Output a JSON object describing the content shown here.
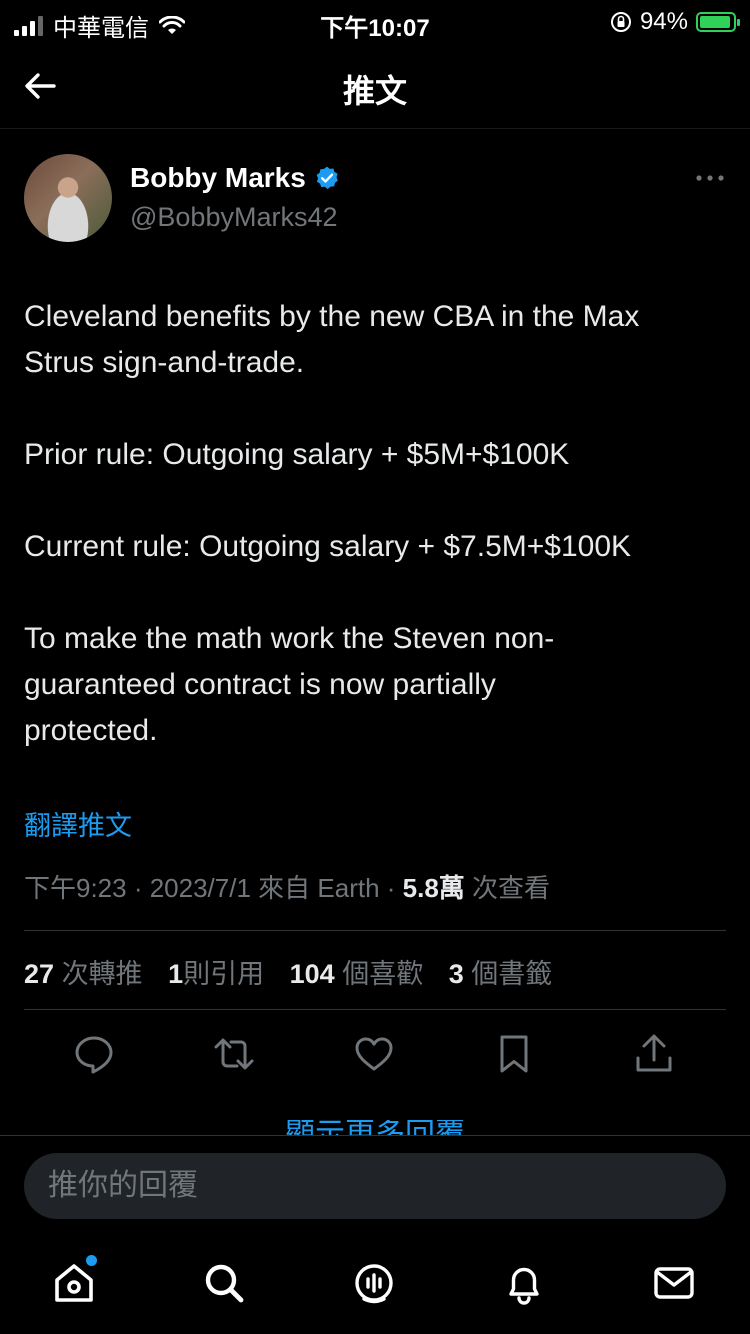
{
  "status_bar": {
    "carrier": "中華電信",
    "time": "下午10:07",
    "battery": "94%",
    "battery_level": 0.94,
    "icons": [
      "signal-icon",
      "wifi-icon",
      "orientation-lock-icon",
      "battery-charging-icon"
    ]
  },
  "header": {
    "title": "推文",
    "back_icon": "back-arrow-icon"
  },
  "tweet": {
    "author_name": "Bobby Marks",
    "author_handle": "@BobbyMarks42",
    "verified_icon": "verified-badge-icon",
    "more_icon": "more-options-icon",
    "body": [
      "Cleveland benefits by the new CBA in the Max\nStrus sign-and-trade.",
      "Prior rule: Outgoing salary + $5M+$100K",
      "Current rule: Outgoing salary + $7.5M+$100K",
      "To make the math work the Steven non-\nguaranteed contract is now partially\nprotected."
    ],
    "translate_label": "翻譯推文",
    "meta": {
      "time": "下午9:23",
      "date": "2023/7/1",
      "source": "來自 Earth",
      "views_count": "5.8萬",
      "views_label": "次查看"
    },
    "stats": [
      {
        "count": "27",
        "label": "次轉推"
      },
      {
        "count": "1",
        "label": "則引用"
      },
      {
        "count": "104",
        "label": "個喜歡"
      },
      {
        "count": "3",
        "label": "個書籤"
      }
    ],
    "actions": [
      "reply-icon",
      "retweet-icon",
      "like-icon",
      "bookmark-icon",
      "share-icon"
    ]
  },
  "more_replies_label": "顯示更多回覆",
  "reply_box": {
    "placeholder": "推你的回覆"
  },
  "tab_bar": {
    "items": [
      "home-icon",
      "search-icon",
      "spaces-icon",
      "notifications-icon",
      "messages-icon"
    ]
  },
  "colors": {
    "accent": "#1d9bf0",
    "background": "#000000",
    "secondary_text": "#71767b",
    "battery": "#30d158"
  }
}
